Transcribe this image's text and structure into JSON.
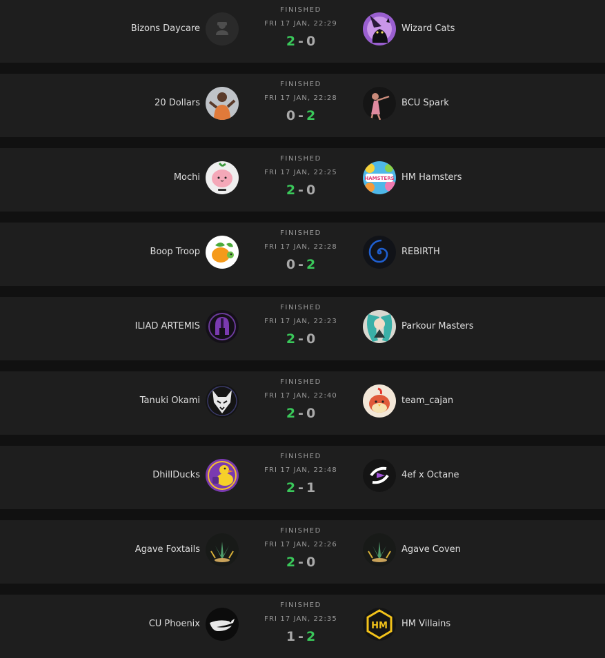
{
  "matches": [
    {
      "status": "FINISHED",
      "date": "FRI 17 JAN, 22:29",
      "team1": {
        "name": "Bizons Daycare",
        "logo": "default-avatar-icon"
      },
      "team2": {
        "name": "Wizard Cats",
        "logo": "wizard-cat-logo"
      },
      "score1": "2",
      "score2": "0",
      "sep": "-",
      "winner": 1
    },
    {
      "status": "FINISHED",
      "date": "FRI 17 JAN, 22:28",
      "team1": {
        "name": "20 Dollars",
        "logo": "player-photo-logo"
      },
      "team2": {
        "name": "BCU Spark",
        "logo": "dancer-photo-logo"
      },
      "score1": "0",
      "score2": "2",
      "sep": "-",
      "winner": 2
    },
    {
      "status": "FINISHED",
      "date": "FRI 17 JAN, 22:25",
      "team1": {
        "name": "Mochi",
        "logo": "mochi-peach-logo"
      },
      "team2": {
        "name": "HM Hamsters",
        "logo": "hamsters-logo"
      },
      "score1": "2",
      "score2": "0",
      "sep": "-",
      "winner": 1
    },
    {
      "status": "FINISHED",
      "date": "FRI 17 JAN, 22:28",
      "team1": {
        "name": "Boop Troop",
        "logo": "orange-turtle-logo"
      },
      "team2": {
        "name": "REBIRTH",
        "logo": "blue-spiral-logo"
      },
      "score1": "0",
      "score2": "2",
      "sep": "-",
      "winner": 2
    },
    {
      "status": "FINISHED",
      "date": "FRI 17 JAN, 22:23",
      "team1": {
        "name": "ILIAD ARTEMIS",
        "logo": "spartan-helmet-logo"
      },
      "team2": {
        "name": "Parkour Masters",
        "logo": "anime-character-logo"
      },
      "score1": "2",
      "score2": "0",
      "sep": "-",
      "winner": 1
    },
    {
      "status": "FINISHED",
      "date": "FRI 17 JAN, 22:40",
      "team1": {
        "name": "Tanuki Okami",
        "logo": "wolf-logo"
      },
      "team2": {
        "name": "team_cajan",
        "logo": "fire-chick-logo"
      },
      "score1": "2",
      "score2": "0",
      "sep": "-",
      "winner": 1
    },
    {
      "status": "FINISHED",
      "date": "FRI 17 JAN, 22:48",
      "team1": {
        "name": "DhillDucks",
        "logo": "duck-logo"
      },
      "team2": {
        "name": "4ef x Octane",
        "logo": "octane-logo"
      },
      "score1": "2",
      "score2": "1",
      "sep": "-",
      "winner": 1
    },
    {
      "status": "FINISHED",
      "date": "FRI 17 JAN, 22:26",
      "team1": {
        "name": "Agave Foxtails",
        "logo": "agave-logo"
      },
      "team2": {
        "name": "Agave Coven",
        "logo": "agave-logo"
      },
      "score1": "2",
      "score2": "0",
      "sep": "-",
      "winner": 1
    },
    {
      "status": "FINISHED",
      "date": "FRI 17 JAN, 22:35",
      "team1": {
        "name": "CU Phoenix",
        "logo": "phoenix-logo"
      },
      "team2": {
        "name": "HM Villains",
        "logo": "hm-villains-logo"
      },
      "score1": "1",
      "score2": "2",
      "sep": "-",
      "winner": 2
    }
  ],
  "colors": {
    "page_background": "#111111",
    "card_background": "#1e1e1e",
    "win_score": "#3ac85a",
    "loss_score": "#a9a9a9",
    "meta_text": "#9a9a9a",
    "team_text": "#dedede"
  }
}
